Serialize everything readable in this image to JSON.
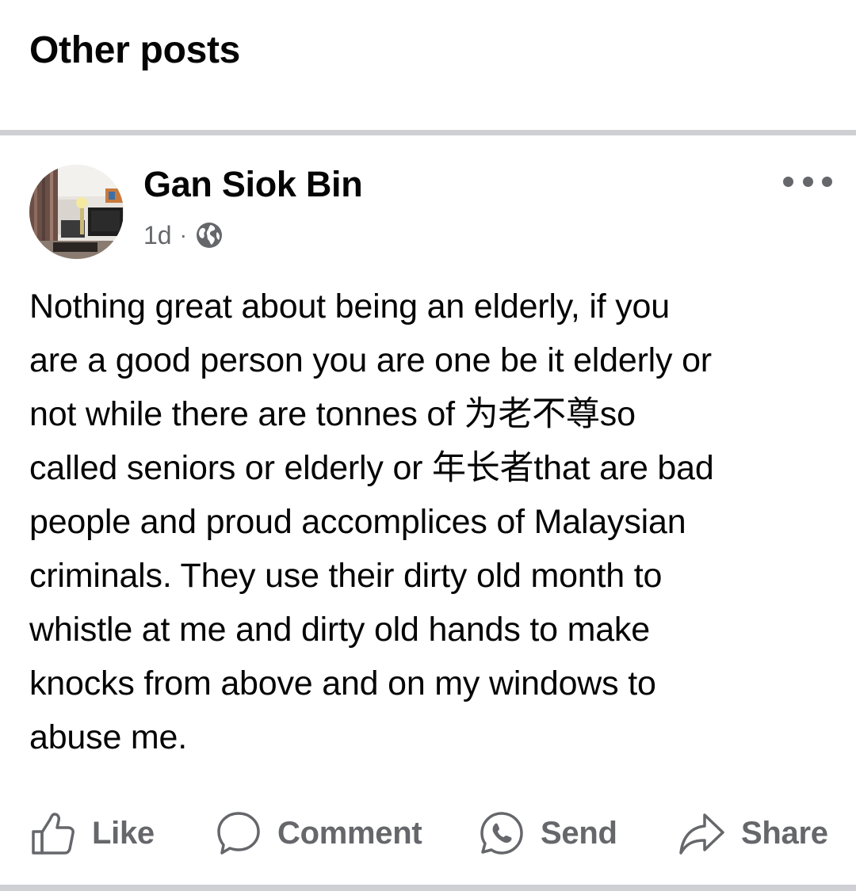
{
  "section": {
    "title": "Other posts"
  },
  "post": {
    "author": "Gan Siok Bin",
    "time": "1d",
    "separator": "·",
    "privacy_icon": "globe-icon",
    "more_icon": "more-options-icon",
    "text": "Nothing great about being an elderly, if you\nare a good person you are one be it elderly or\nnot while there are tonnes of 为老不尊so\ncalled seniors or elderly or 年长者that are bad\npeople and proud accomplices of Malaysian\ncriminals.  They use their dirty old month to\nwhistle at me and dirty old hands to make\nknocks from above and on my windows to\nabuse me."
  },
  "actions": {
    "like": "Like",
    "comment": "Comment",
    "send": "Send",
    "share": "Share"
  },
  "colors": {
    "text": "#050505",
    "secondary": "#65676b",
    "divider": "#ced0d4"
  }
}
